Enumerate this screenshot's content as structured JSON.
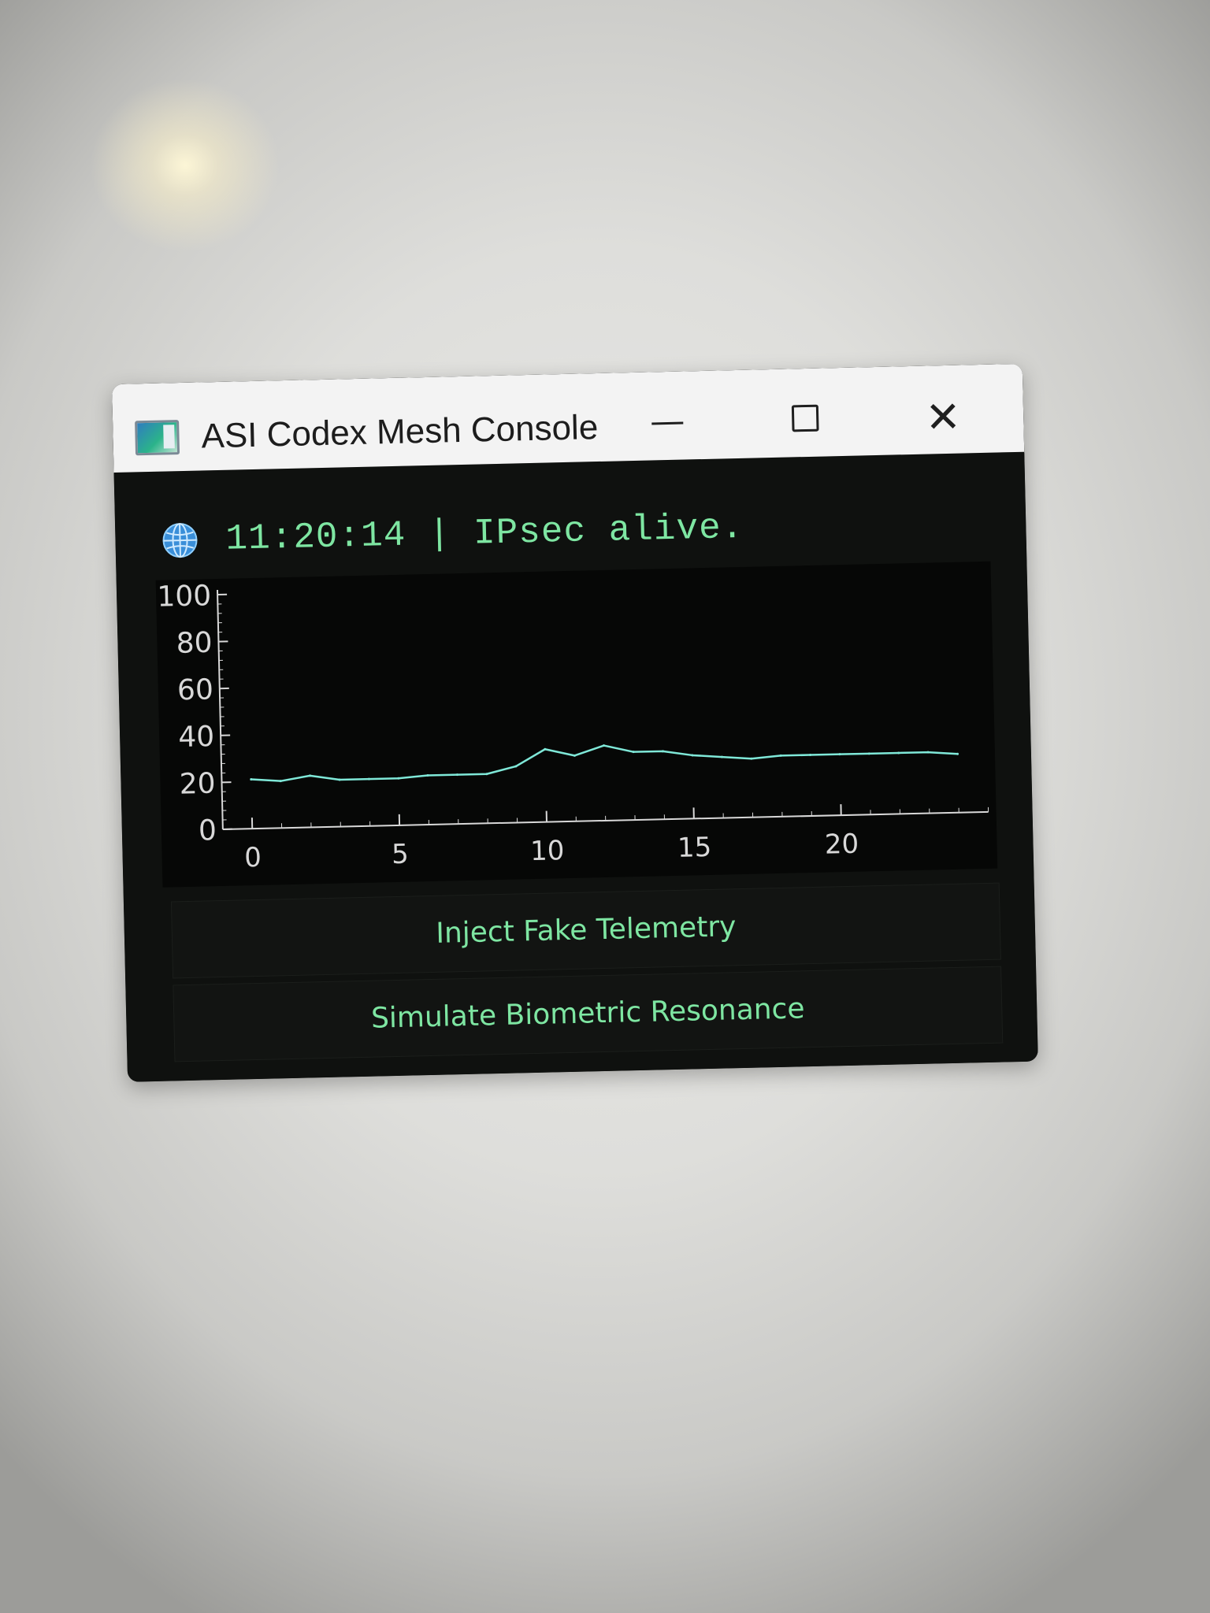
{
  "window": {
    "title": "ASI Codex Mesh Console",
    "controls": {
      "minimize_icon": "minimize-icon",
      "maximize_icon": "maximize-icon",
      "close_icon": "close-icon"
    }
  },
  "status": {
    "icon": "globe-icon",
    "text": "11:20:14 | IPsec alive."
  },
  "actions": {
    "inject_label": "Inject Fake Telemetry",
    "simulate_label": "Simulate Biometric Resonance"
  },
  "colors": {
    "accent": "#7ee6a2",
    "line": "#7fe8d8",
    "background": "#0f110f",
    "titlebar": "#f3f3f3"
  },
  "chart_data": {
    "type": "line",
    "title": "",
    "xlabel": "",
    "ylabel": "",
    "xlim": [
      -1,
      25
    ],
    "ylim": [
      0,
      100
    ],
    "x_ticks": [
      0,
      5,
      10,
      15,
      20
    ],
    "y_ticks": [
      0,
      20,
      40,
      60,
      80,
      100
    ],
    "grid": false,
    "legend": "none",
    "series": [
      {
        "name": "",
        "x": [
          0,
          1,
          2,
          3,
          4,
          5,
          6,
          7,
          8,
          9,
          10,
          11,
          12,
          13,
          14,
          15,
          16,
          17,
          18,
          19,
          20,
          21,
          22,
          23,
          24
        ],
        "y": [
          21,
          20,
          22,
          20,
          20,
          20,
          21,
          21,
          21,
          24,
          31,
          28,
          32,
          29,
          29,
          27,
          26,
          25,
          26,
          26,
          26,
          26,
          26,
          26,
          25
        ]
      }
    ]
  }
}
